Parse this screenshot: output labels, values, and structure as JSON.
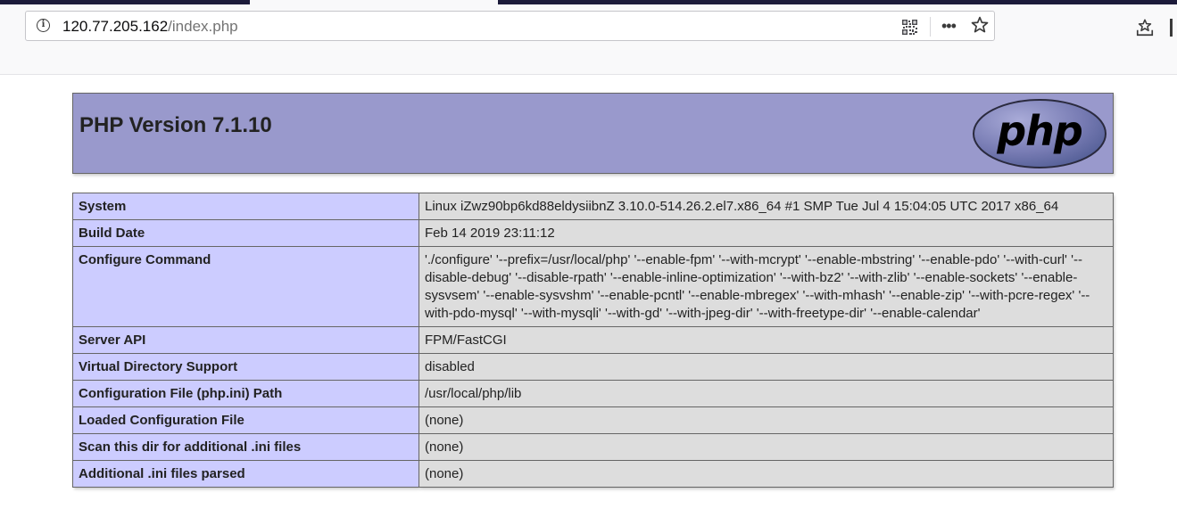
{
  "browser": {
    "url_host": "120.77.205.162",
    "url_path": "/index.php",
    "icons": {
      "info": "info-icon",
      "qr": "qr-code-icon",
      "more": "more-icon",
      "bookmark": "star-icon",
      "library": "library-icon"
    },
    "info_glyph": "i",
    "more_glyph": "•••"
  },
  "header": {
    "title": "PHP Version 7.1.10",
    "logo_text": "php",
    "colors": {
      "bar": "#9999cc",
      "logo": "#777bb3"
    }
  },
  "rows": [
    {
      "label": "System",
      "value": "Linux iZwz90bp6kd88eldysiibnZ 3.10.0-514.26.2.el7.x86_64 #1 SMP Tue Jul 4 15:04:05 UTC 2017 x86_64"
    },
    {
      "label": "Build Date",
      "value": "Feb 14 2019 23:11:12"
    },
    {
      "label": "Configure Command",
      "value": "'./configure' '--prefix=/usr/local/php' '--enable-fpm' '--with-mcrypt' '--enable-mbstring' '--enable-pdo' '--with-curl' '--disable-debug' '--disable-rpath' '--enable-inline-optimization' '--with-bz2' '--with-zlib' '--enable-sockets' '--enable-sysvsem' '--enable-sysvshm' '--enable-pcntl' '--enable-mbregex' '--with-mhash' '--enable-zip' '--with-pcre-regex' '--with-pdo-mysql' '--with-mysqli' '--with-gd' '--with-jpeg-dir' '--with-freetype-dir' '--enable-calendar'"
    },
    {
      "label": "Server API",
      "value": "FPM/FastCGI"
    },
    {
      "label": "Virtual Directory Support",
      "value": "disabled"
    },
    {
      "label": "Configuration File (php.ini) Path",
      "value": "/usr/local/php/lib"
    },
    {
      "label": "Loaded Configuration File",
      "value": "(none)"
    },
    {
      "label": "Scan this dir for additional .ini files",
      "value": "(none)"
    },
    {
      "label": "Additional .ini files parsed",
      "value": "(none)"
    }
  ]
}
